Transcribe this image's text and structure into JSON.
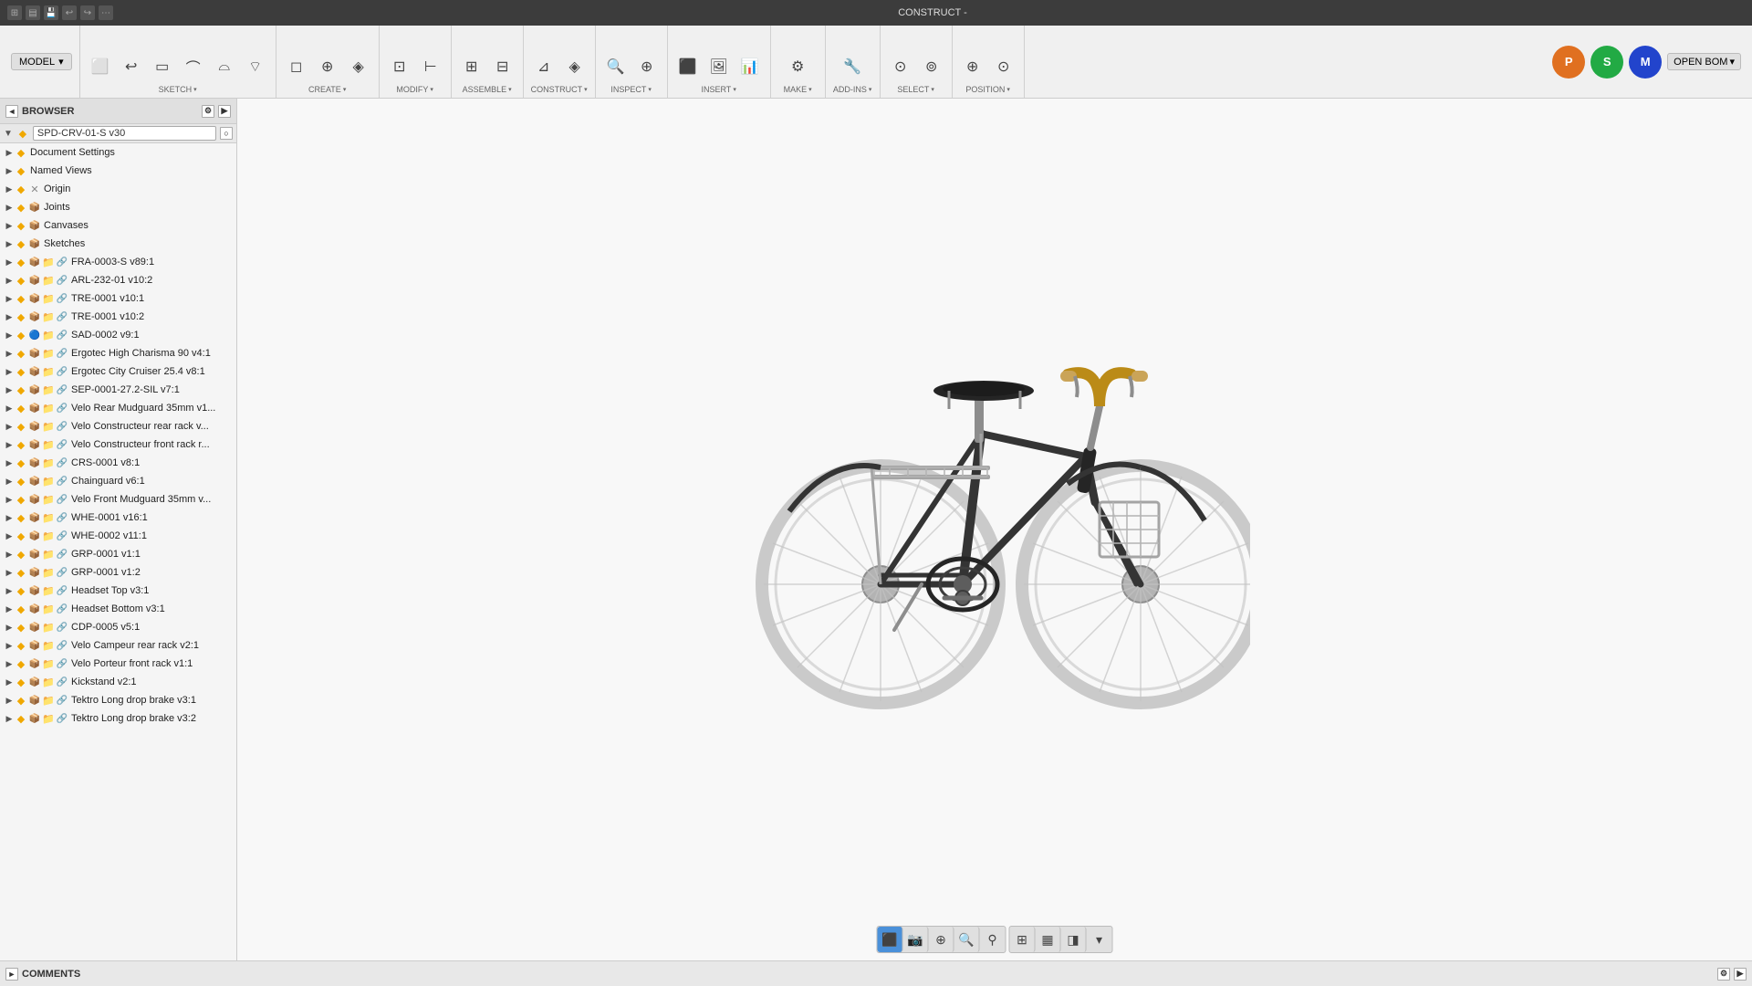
{
  "titlebar": {
    "app_icon": "⊞",
    "file_icon": "📄",
    "save_icon": "💾",
    "undo_icon": "↩",
    "redo_icon": "↪",
    "title": "CONSTRUCT -"
  },
  "toolbar": {
    "model_label": "MODEL",
    "sketch_label": "SKETCH",
    "create_label": "CREATE",
    "modify_label": "MODIFY",
    "assemble_label": "ASSEMBLE",
    "construct_label": "CONSTRUCT",
    "inspect_label": "INSPECT",
    "insert_label": "INSERT",
    "make_label": "MAKE",
    "addins_label": "ADD-INS",
    "select_label": "SELECT",
    "position_label": "POSITION",
    "open_bom_label": "OPEN BOM",
    "profiles": [
      {
        "label": "P",
        "color": "#e07020"
      },
      {
        "label": "S",
        "color": "#22aa44"
      },
      {
        "label": "M",
        "color": "#2244cc"
      }
    ]
  },
  "browser": {
    "title": "BROWSER",
    "active_component": "SPD-CRV-01-S v30",
    "items": [
      {
        "level": 1,
        "label": "Document Settings",
        "has_arrow": true,
        "icons": [
          "gear"
        ]
      },
      {
        "level": 1,
        "label": "Named Views",
        "has_arrow": true,
        "icons": [
          "eye"
        ]
      },
      {
        "level": 1,
        "label": "Origin",
        "has_arrow": true,
        "icons": [
          "folder",
          "origin"
        ]
      },
      {
        "level": 1,
        "label": "Joints",
        "has_arrow": true,
        "icons": [
          "yellow",
          "folder"
        ]
      },
      {
        "level": 1,
        "label": "Canvases",
        "has_arrow": true,
        "icons": [
          "yellow",
          "folder"
        ]
      },
      {
        "level": 1,
        "label": "Sketches",
        "has_arrow": true,
        "icons": [
          "yellow",
          "folder"
        ]
      },
      {
        "level": 1,
        "label": "FRA-0003-S v89:1",
        "has_arrow": true,
        "icons": [
          "yellow",
          "box",
          "folder",
          "link"
        ]
      },
      {
        "level": 1,
        "label": "ARL-232-01 v10:2",
        "has_arrow": true,
        "icons": [
          "yellow",
          "box",
          "folder",
          "link"
        ]
      },
      {
        "level": 1,
        "label": "TRE-0001 v10:1",
        "has_arrow": true,
        "icons": [
          "yellow",
          "box",
          "folder",
          "link"
        ]
      },
      {
        "level": 1,
        "label": "TRE-0001 v10:2",
        "has_arrow": true,
        "icons": [
          "yellow",
          "box",
          "folder",
          "link"
        ]
      },
      {
        "level": 1,
        "label": "SAD-0002 v9:1",
        "has_arrow": true,
        "icons": [
          "yellow",
          "special",
          "folder",
          "link"
        ]
      },
      {
        "level": 1,
        "label": "Ergotec High Charisma 90 v4:1",
        "has_arrow": true,
        "icons": [
          "yellow",
          "box",
          "folder",
          "link"
        ]
      },
      {
        "level": 1,
        "label": "Ergotec City Cruiser 25.4 v8:1",
        "has_arrow": true,
        "icons": [
          "yellow",
          "box",
          "folder",
          "link"
        ]
      },
      {
        "level": 1,
        "label": "SEP-0001-27.2-SIL v7:1",
        "has_arrow": true,
        "icons": [
          "yellow",
          "box",
          "folder",
          "link"
        ]
      },
      {
        "level": 1,
        "label": "Velo Rear Mudguard 35mm v1...",
        "has_arrow": true,
        "icons": [
          "yellow",
          "box",
          "folder",
          "link"
        ]
      },
      {
        "level": 1,
        "label": "Velo Constructeur rear rack v...",
        "has_arrow": true,
        "icons": [
          "yellow",
          "box",
          "folder",
          "link"
        ]
      },
      {
        "level": 1,
        "label": "Velo Constructeur front rack r...",
        "has_arrow": true,
        "icons": [
          "yellow",
          "box",
          "folder",
          "link"
        ]
      },
      {
        "level": 1,
        "label": "CRS-0001 v8:1",
        "has_arrow": true,
        "icons": [
          "yellow",
          "box",
          "folder",
          "link"
        ]
      },
      {
        "level": 1,
        "label": "Chainguard v6:1",
        "has_arrow": true,
        "icons": [
          "yellow",
          "box",
          "folder",
          "link"
        ]
      },
      {
        "level": 1,
        "label": "Velo Front Mudguard 35mm v...",
        "has_arrow": true,
        "icons": [
          "yellow",
          "box",
          "folder",
          "link"
        ]
      },
      {
        "level": 1,
        "label": "WHE-0001 v16:1",
        "has_arrow": true,
        "icons": [
          "yellow",
          "box",
          "folder",
          "link"
        ]
      },
      {
        "level": 1,
        "label": "WHE-0002 v11:1",
        "has_arrow": true,
        "icons": [
          "yellow",
          "box",
          "folder",
          "link"
        ]
      },
      {
        "level": 1,
        "label": "GRP-0001 v1:1",
        "has_arrow": true,
        "icons": [
          "yellow",
          "box",
          "folder",
          "link"
        ]
      },
      {
        "level": 1,
        "label": "GRP-0001 v1:2",
        "has_arrow": true,
        "icons": [
          "yellow",
          "box",
          "folder",
          "link"
        ]
      },
      {
        "level": 1,
        "label": "Headset Top v3:1",
        "has_arrow": true,
        "icons": [
          "yellow",
          "box",
          "folder",
          "link"
        ]
      },
      {
        "level": 1,
        "label": "Headset Bottom v3:1",
        "has_arrow": true,
        "icons": [
          "yellow",
          "box",
          "folder",
          "link"
        ]
      },
      {
        "level": 1,
        "label": "CDP-0005 v5:1",
        "has_arrow": true,
        "icons": [
          "yellow",
          "box",
          "folder",
          "link"
        ]
      },
      {
        "level": 1,
        "label": "Velo Campeur rear rack v2:1",
        "has_arrow": true,
        "icons": [
          "yellow",
          "box",
          "folder",
          "link"
        ]
      },
      {
        "level": 1,
        "label": "Velo Porteur front rack v1:1",
        "has_arrow": true,
        "icons": [
          "yellow",
          "box",
          "folder",
          "link"
        ]
      },
      {
        "level": 1,
        "label": "Kickstand v2:1",
        "has_arrow": true,
        "icons": [
          "yellow",
          "box",
          "folder",
          "link"
        ]
      },
      {
        "level": 1,
        "label": "Tektro Long drop brake v3:1",
        "has_arrow": true,
        "icons": [
          "yellow",
          "box",
          "folder",
          "link"
        ]
      },
      {
        "level": 1,
        "label": "Tektro Long drop brake v3:2",
        "has_arrow": true,
        "icons": [
          "yellow",
          "box",
          "folder",
          "link"
        ]
      }
    ]
  },
  "bottom": {
    "comments_label": "COMMENTS",
    "view_buttons": [
      "cube",
      "camera",
      "cursor",
      "zoom-fit",
      "search",
      "grid",
      "display",
      "render"
    ]
  }
}
